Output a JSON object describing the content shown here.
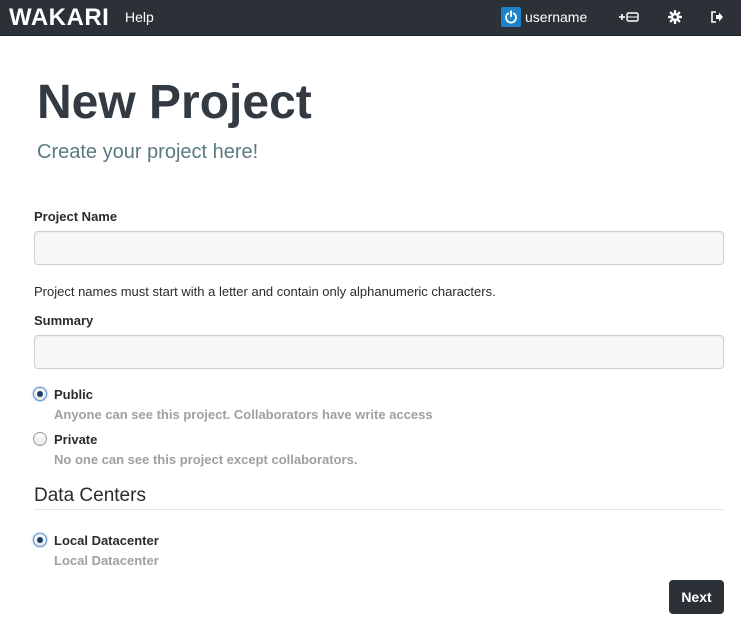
{
  "navbar": {
    "brand": "WAKARI",
    "help": "Help",
    "username": "username",
    "icons": {
      "power": "power-icon",
      "add_drive": "add-drive-icon",
      "settings": "gear-icon",
      "logout": "logout-icon"
    }
  },
  "page": {
    "title": "New Project",
    "subtitle": "Create your project here!"
  },
  "form": {
    "project_name": {
      "label": "Project Name",
      "value": "",
      "help": "Project names must start with a letter and contain only alphanumeric characters."
    },
    "summary": {
      "label": "Summary",
      "value": ""
    },
    "visibility": [
      {
        "label": "Public",
        "description": "Anyone can see this project. Collaborators have write access",
        "selected": true
      },
      {
        "label": "Private",
        "description": "No one can see this project except collaborators.",
        "selected": false
      }
    ],
    "data_centers": {
      "heading": "Data Centers",
      "options": [
        {
          "label": "Local Datacenter",
          "description": "Local Datacenter",
          "selected": true
        }
      ]
    },
    "next_label": "Next"
  },
  "colors": {
    "navbar": "#2c3137",
    "accent": "#1c83c8",
    "subtitle": "#5a7a7f",
    "muted": "#a0a0a0"
  }
}
